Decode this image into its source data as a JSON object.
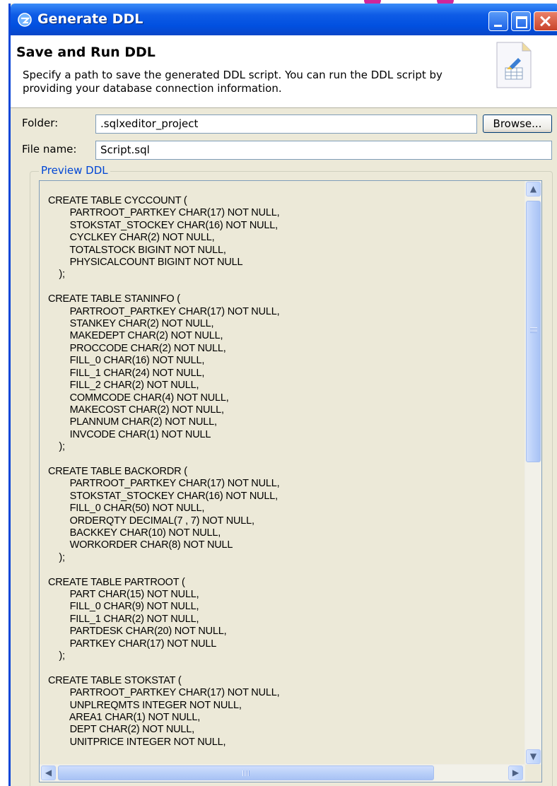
{
  "window": {
    "title": "Generate DDL"
  },
  "header": {
    "title": "Save and Run DDL",
    "description": "Specify a path to save the generated DDL script. You can run the DDL script by providing your database connection information."
  },
  "form": {
    "folder_label": "Folder:",
    "folder_value": ".sqlxeditor_project",
    "browse_label": "Browse...",
    "filename_label": "File name:",
    "filename_value": "Script.sql"
  },
  "preview": {
    "group_label": "Preview DDL",
    "ddl": "CREATE TABLE CYCCOUNT (\n        PARTROOT_PARTKEY CHAR(17) NOT NULL,\n        STOKSTAT_STOCKEY CHAR(16) NOT NULL,\n        CYCLKEY CHAR(2) NOT NULL,\n        TOTALSTOCK BIGINT NOT NULL,\n        PHYSICALCOUNT BIGINT NOT NULL\n    );\n\nCREATE TABLE STANINFO (\n        PARTROOT_PARTKEY CHAR(17) NOT NULL,\n        STANKEY CHAR(2) NOT NULL,\n        MAKEDEPT CHAR(2) NOT NULL,\n        PROCCODE CHAR(2) NOT NULL,\n        FILL_0 CHAR(16) NOT NULL,\n        FILL_1 CHAR(24) NOT NULL,\n        FILL_2 CHAR(2) NOT NULL,\n        COMMCODE CHAR(4) NOT NULL,\n        MAKECOST CHAR(2) NOT NULL,\n        PLANNUM CHAR(2) NOT NULL,\n        INVCODE CHAR(1) NOT NULL\n    );\n\nCREATE TABLE BACKORDR (\n        PARTROOT_PARTKEY CHAR(17) NOT NULL,\n        STOKSTAT_STOCKEY CHAR(16) NOT NULL,\n        FILL_0 CHAR(50) NOT NULL,\n        ORDERQTY DECIMAL(7 , 7) NOT NULL,\n        BACKKEY CHAR(10) NOT NULL,\n        WORKORDER CHAR(8) NOT NULL\n    );\n\nCREATE TABLE PARTROOT (\n        PART CHAR(15) NOT NULL,\n        FILL_0 CHAR(9) NOT NULL,\n        FILL_1 CHAR(2) NOT NULL,\n        PARTDESK CHAR(20) NOT NULL,\n        PARTKEY CHAR(17) NOT NULL\n    );\n\nCREATE TABLE STOKSTAT (\n        PARTROOT_PARTKEY CHAR(17) NOT NULL,\n        UNPLREQMTS INTEGER NOT NULL,\n        AREA1 CHAR(1) NOT NULL,\n        DEPT CHAR(2) NOT NULL,\n        UNITPRICE INTEGER NOT NULL,"
  },
  "colors": {
    "titlebar": "#0150e0",
    "dialog_bg": "#ece9d8",
    "group_label": "#0046d5"
  },
  "icons": [
    "app-icon",
    "minimize-icon",
    "maximize-icon",
    "close-icon",
    "wizard-table-icon",
    "arrow-up-icon",
    "arrow-down-icon",
    "arrow-left-icon",
    "arrow-right-icon"
  ]
}
